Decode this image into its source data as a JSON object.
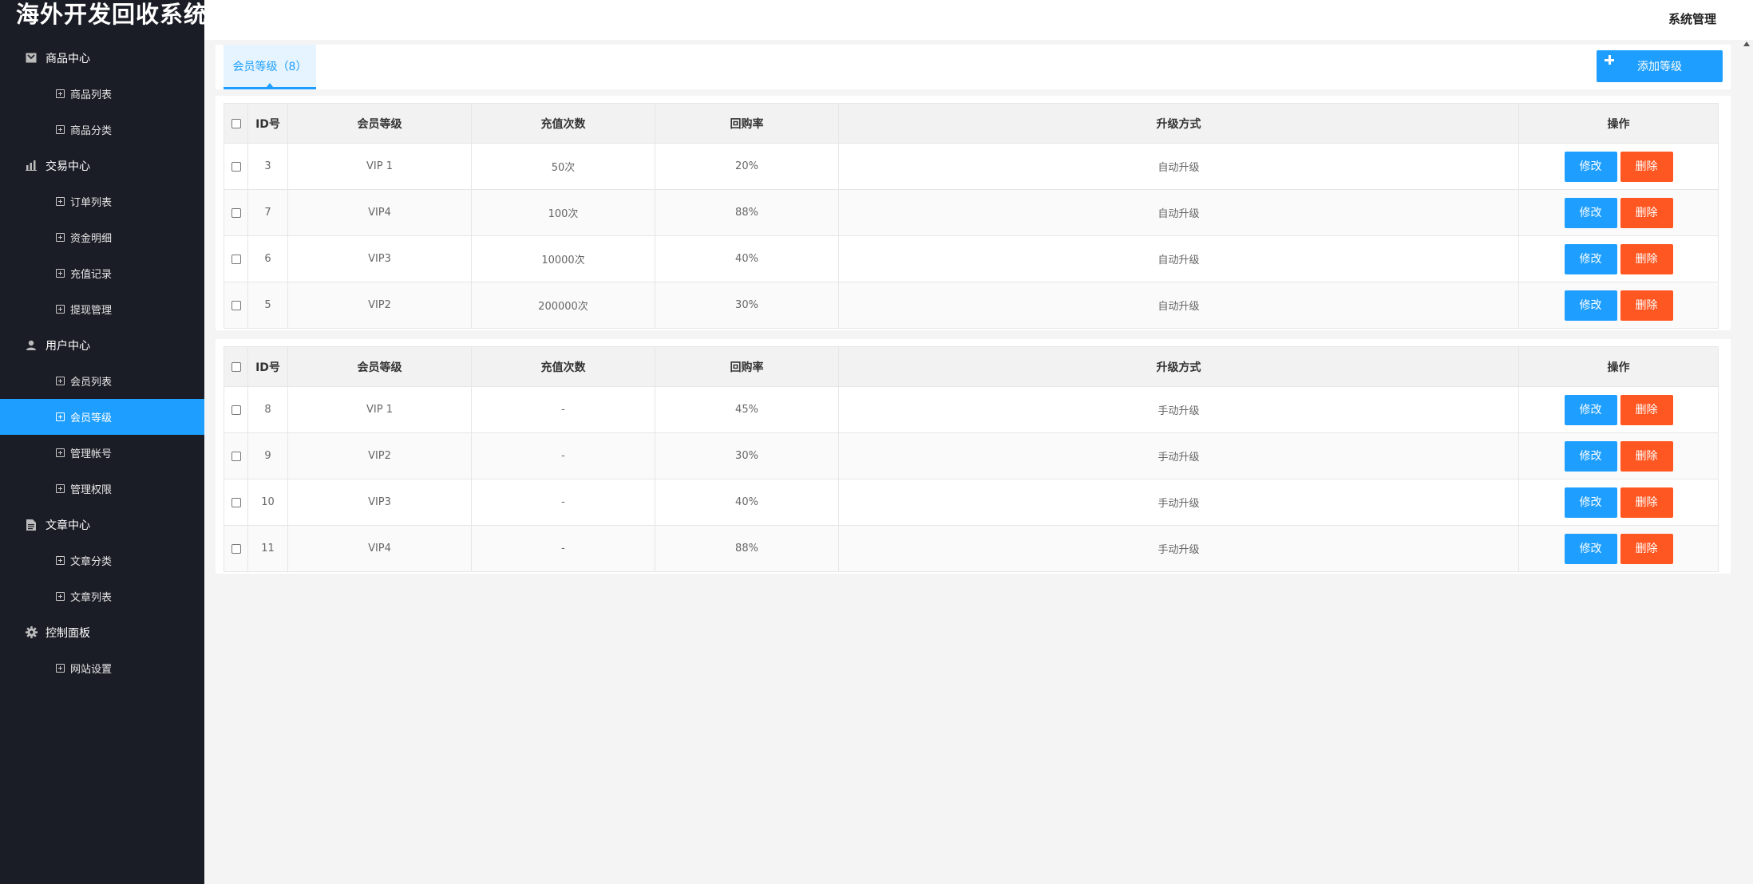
{
  "app": {
    "title": "海外开发回收系统"
  },
  "header": {
    "right_label": "系统管理"
  },
  "sidebar": {
    "groups": [
      {
        "label": "商品中心",
        "icon": "shop-icon",
        "items": [
          "商品列表",
          "商品分类"
        ]
      },
      {
        "label": "交易中心",
        "icon": "chart-icon",
        "items": [
          "订单列表",
          "资金明细",
          "充值记录",
          "提现管理"
        ]
      },
      {
        "label": "用户中心",
        "icon": "user-icon",
        "items": [
          "会员列表",
          "会员等级",
          "管理帐号",
          "管理权限"
        ]
      },
      {
        "label": "文章中心",
        "icon": "document-icon",
        "items": [
          "文章分类",
          "文章列表"
        ]
      },
      {
        "label": "控制面板",
        "icon": "gear-icon",
        "items": [
          "网站设置"
        ]
      }
    ],
    "active_item": "会员等级"
  },
  "tabs": [
    {
      "label": "会员等级（8）",
      "active": true
    }
  ],
  "toolbar": {
    "add_label": "添加等级"
  },
  "table_headers": [
    "ID号",
    "会员等级",
    "充值次数",
    "回购率",
    "升级方式",
    "操作"
  ],
  "actions": {
    "edit": "修改",
    "delete": "删除"
  },
  "tables": [
    {
      "rows": [
        {
          "id": "3",
          "level": "VIP 1",
          "recharge": "50次",
          "rate": "20%",
          "method": "自动升级"
        },
        {
          "id": "7",
          "level": "VIP4",
          "recharge": "100次",
          "rate": "88%",
          "method": "自动升级"
        },
        {
          "id": "6",
          "level": "VIP3",
          "recharge": "10000次",
          "rate": "40%",
          "method": "自动升级"
        },
        {
          "id": "5",
          "level": "VIP2",
          "recharge": "200000次",
          "rate": "30%",
          "method": "自动升级"
        }
      ]
    },
    {
      "rows": [
        {
          "id": "8",
          "level": "VIP 1",
          "recharge": "-",
          "rate": "45%",
          "method": "手动升级"
        },
        {
          "id": "9",
          "level": "VIP2",
          "recharge": "-",
          "rate": "30%",
          "method": "手动升级"
        },
        {
          "id": "10",
          "level": "VIP3",
          "recharge": "-",
          "rate": "40%",
          "method": "手动升级"
        },
        {
          "id": "11",
          "level": "VIP4",
          "recharge": "-",
          "rate": "88%",
          "method": "手动升级"
        }
      ]
    }
  ],
  "colors": {
    "primary": "#1e9fff",
    "danger": "#ff5722",
    "sidebar_bg": "#1b1d26"
  }
}
